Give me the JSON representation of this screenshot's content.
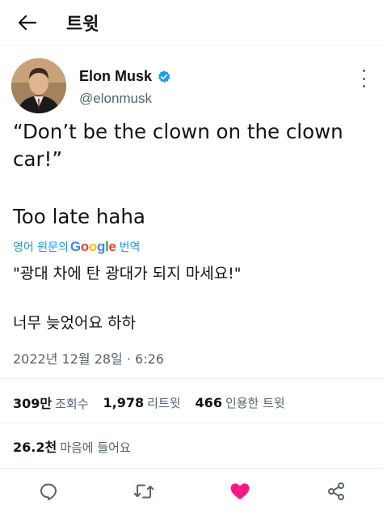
{
  "header": {
    "back_icon": "arrow-left-icon",
    "title": "트윗"
  },
  "author": {
    "name": "Elon Musk",
    "handle": "@elonmusk",
    "verified_icon": "verified-badge-icon",
    "verified_color": "#1d9bf0"
  },
  "tweet": {
    "text": "“Don’t be the clown on the clown car!”",
    "text_line2": "Too late haha"
  },
  "translation": {
    "prefix": "영어 원문의",
    "google": [
      "G",
      "o",
      "o",
      "g",
      "l",
      "e"
    ],
    "suffix": "번역",
    "line1": "\"광대 차에 탄 광대가 되지 마세요!\"",
    "line2": "너무 늦었어요 하하"
  },
  "meta": {
    "timestamp": "2022년 12월 28일 · 6:26"
  },
  "stats": {
    "views_count": "309만",
    "views_label": "조회수",
    "retweets_count": "1,978",
    "retweets_label": "리트윗",
    "quotes_count": "466",
    "quotes_label": "인용한 트윗"
  },
  "likes": {
    "count": "26.2천",
    "label": "마음에 들어요"
  },
  "actions": {
    "reply_icon": "reply-icon",
    "retweet_icon": "retweet-icon",
    "like_icon": "heart-icon",
    "share_icon": "share-icon",
    "like_color": "#f91880",
    "icon_color": "#536471"
  },
  "colors": {
    "accent": "#1d9bf0",
    "text": "#0f1419",
    "secondary": "#536471"
  }
}
